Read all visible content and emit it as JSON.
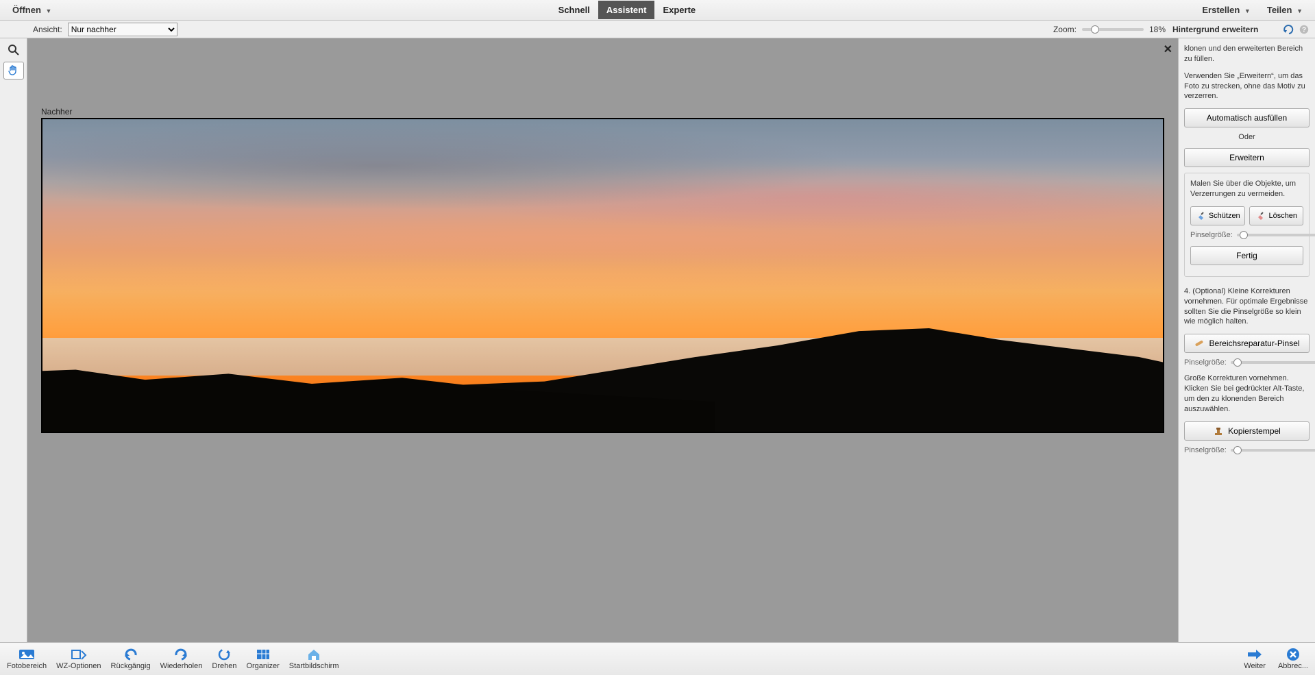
{
  "topbar": {
    "open": "Öffnen",
    "create": "Erstellen",
    "share": "Teilen",
    "tabs": {
      "fast": "Schnell",
      "guided": "Assistent",
      "expert": "Experte",
      "active": "guided"
    }
  },
  "secondbar": {
    "view_label": "Ansicht:",
    "view_value": "Nur nachher",
    "zoom_label": "Zoom:",
    "zoom_value": "18%"
  },
  "panel": {
    "title": "Hintergrund erweitern",
    "p1": "klonen und den erweiterten Bereich zu füllen.",
    "p2": "Verwenden Sie „Erweitern“, um das Foto zu strecken, ohne das Motiv zu verzerren.",
    "auto_fill": "Automatisch ausfüllen",
    "or": "Oder",
    "extend": "Erweitern",
    "paint_hint": "Malen Sie über die Objekte, um Verzerrungen zu vermeiden.",
    "protect": "Schützen",
    "delete": "Löschen",
    "brush_size": "Pinselgröße:",
    "done": "Fertig",
    "step4": "4. (Optional) Kleine Korrekturen vornehmen. Für optimale Ergebnisse sollten Sie die Pinselgröße so klein wie möglich halten.",
    "spot_heal": "Bereichsreparatur-Pinsel",
    "big_corr": "Große Korrekturen vornehmen. Klicken Sie bei gedrückter Alt-Taste, um den zu klonenden Bereich auszuwählen.",
    "clone": "Kopierstempel"
  },
  "canvas": {
    "after": "Nachher"
  },
  "bottombar": {
    "photo_bin": "Fotobereich",
    "tool_opts": "WZ-Optionen",
    "undo": "Rückgängig",
    "redo": "Wiederholen",
    "rotate": "Drehen",
    "organizer": "Organizer",
    "home": "Startbildschirm",
    "next": "Weiter",
    "cancel": "Abbrec..."
  }
}
